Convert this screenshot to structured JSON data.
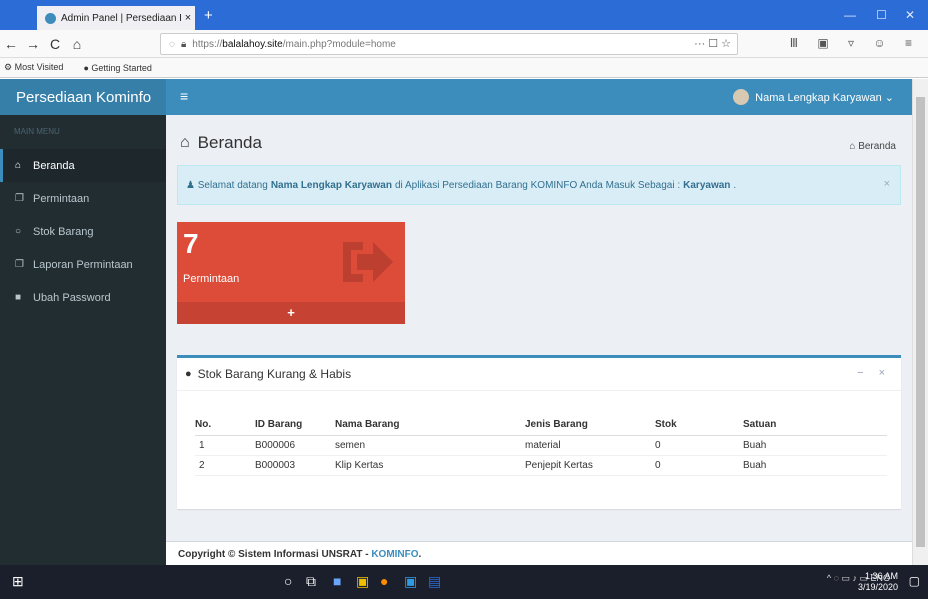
{
  "browser": {
    "tab_title": "Admin Panel | Persediaan Komi",
    "tab_close": "×",
    "new_tab": "+",
    "url_prefix": "https://",
    "url_domain": "balalahoy.site",
    "url_path": "/main.php?module=home",
    "url_actions": "··· ☐ ☆",
    "bookmarks": [
      "Most Visited",
      "Getting Started"
    ]
  },
  "app": {
    "brand": "Persediaan Kominfo",
    "menu_toggle": "≡",
    "user_name": "Nama Lengkap Karyawan ⌄"
  },
  "sidebar": {
    "header": "MAIN MENU",
    "items": [
      {
        "label": "Beranda",
        "icon": "home-icon",
        "active": true
      },
      {
        "label": "Permintaan",
        "icon": "copy-icon"
      },
      {
        "label": "Stok Barang",
        "icon": "circle-icon"
      },
      {
        "label": "Laporan Permintaan",
        "icon": "copy-icon"
      },
      {
        "label": "Ubah Password",
        "icon": "lock-icon"
      }
    ]
  },
  "content": {
    "title": "Beranda",
    "breadcrumb": "Beranda",
    "alert": {
      "prefix": "Selamat datang",
      "user": "Nama Lengkap Karyawan",
      "middle": "di Aplikasi Persediaan Barang KOMINFO Anda Masuk Sebagai :",
      "role": "Karyawan",
      "suffix": "."
    },
    "smallbox": {
      "count": "7",
      "label": "Permintaan",
      "footer": "+",
      "color": "#dd4b39"
    },
    "box": {
      "title": "Stok Barang Kurang & Habis",
      "tools": "− ×",
      "columns": [
        "No.",
        "ID Barang",
        "Nama Barang",
        "Jenis Barang",
        "Stok",
        "Satuan"
      ],
      "rows": [
        [
          "1",
          "B000006",
          "semen",
          "material",
          "0",
          "Buah"
        ],
        [
          "2",
          "B000003",
          "Klip Kertas",
          "Penjepit Kertas",
          "0",
          "Buah"
        ]
      ]
    },
    "footer": {
      "text": "Copyright © Sistem Informasi UNSRAT - ",
      "link": "KOMINFO",
      "end": "."
    }
  },
  "taskbar": {
    "time": "1:36 AM",
    "date": "3/19/2020",
    "lang": "ENG"
  }
}
